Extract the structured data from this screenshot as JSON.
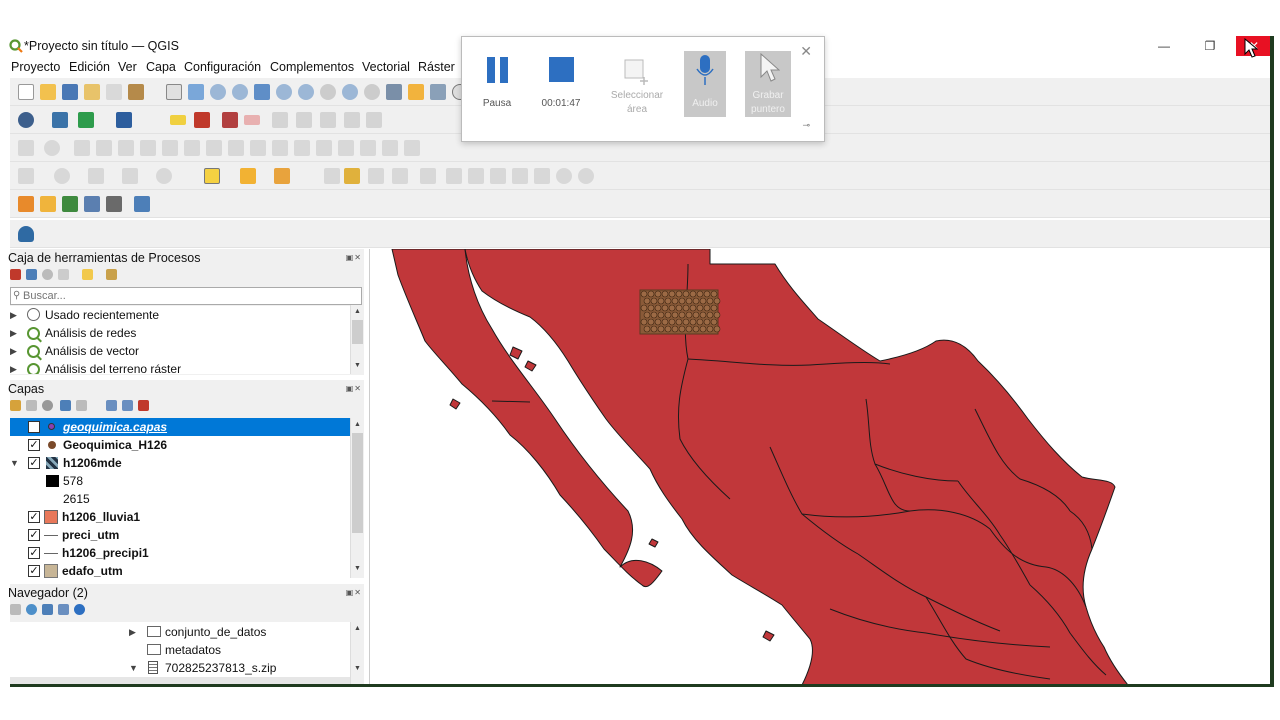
{
  "window": {
    "title": "*Proyecto sin título — QGIS",
    "minimize": "—",
    "restore": "❐",
    "close": "✕"
  },
  "menu": [
    "Proyecto",
    "Edición",
    "Ver",
    "Capa",
    "Configuración",
    "Complementos",
    "Vectorial",
    "Ráster"
  ],
  "processing": {
    "title": "Caja de herramientas de Procesos",
    "search_placeholder": "Buscar...",
    "items": [
      {
        "label": "Usado recientemente",
        "icon": "clock-icon"
      },
      {
        "label": "Análisis de redes",
        "icon": "qgis-icon"
      },
      {
        "label": "Análisis de vector",
        "icon": "qgis-icon"
      },
      {
        "label": "Análisis del terreno ráster",
        "icon": "qgis-icon"
      }
    ]
  },
  "layers": {
    "title": "Capas",
    "items": [
      {
        "name": "geoquimica.capas",
        "checked": false,
        "selected": true,
        "symbol": "point-purple",
        "italic": true
      },
      {
        "name": "Geoquimica_H126",
        "checked": true,
        "symbol": "point-brown"
      },
      {
        "name": "h1206mde",
        "checked": true,
        "symbol": "raster",
        "expanded": true
      },
      {
        "name": "578",
        "legend": true,
        "symbol": "black-swatch"
      },
      {
        "name": "2615",
        "legend": true,
        "symbol": "white-swatch"
      },
      {
        "name": "h1206_lluvia1",
        "checked": true,
        "symbol": "fill-orange"
      },
      {
        "name": "preci_utm",
        "checked": true,
        "symbol": "line"
      },
      {
        "name": "h1206_precipi1",
        "checked": true,
        "symbol": "line"
      },
      {
        "name": "edafo_utm",
        "checked": true,
        "symbol": "fill-tan"
      }
    ]
  },
  "browser": {
    "title": "Navegador (2)",
    "items": [
      {
        "label": "conjunto_de_datos",
        "icon": "folder-icon",
        "arrow": "▶"
      },
      {
        "label": "metadatos",
        "icon": "folder-icon",
        "arrow": ""
      },
      {
        "label": "702825237813_s.zip",
        "icon": "zip-icon",
        "arrow": "▼"
      }
    ]
  },
  "recorder": {
    "pause_label": "Pausa",
    "time_label": "00:01:47",
    "select_area_label": "Seleccionar área",
    "audio_label": "Audio",
    "pointer_label": "Grabar puntero",
    "close": "✕",
    "pin": "⊸"
  },
  "colors": {
    "map_fill": "#c1373a",
    "selection": "#0078d7",
    "accent_blue": "#2d6fc1",
    "close_red": "#e81123"
  }
}
